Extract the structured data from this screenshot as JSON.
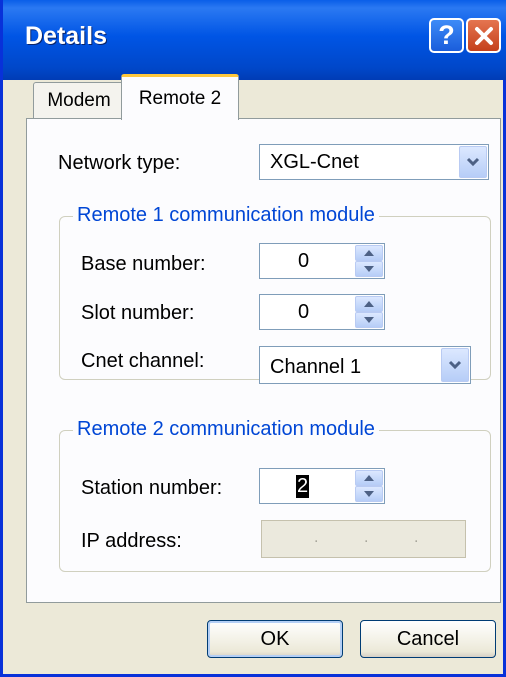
{
  "window": {
    "title": "Details"
  },
  "tabs": [
    {
      "label": "Modem",
      "selected": false
    },
    {
      "label": "Remote 2",
      "selected": true
    }
  ],
  "network_type": {
    "label": "Network type:",
    "value": "XGL-Cnet"
  },
  "remote1": {
    "title": "Remote 1 communication module",
    "base_number": {
      "label": "Base number:",
      "value": "0"
    },
    "slot_number": {
      "label": "Slot number:",
      "value": "0"
    },
    "cnet_channel": {
      "label": "Cnet channel:",
      "value": "Channel 1"
    }
  },
  "remote2": {
    "title": "Remote 2 communication module",
    "station_number": {
      "label": "Station number:",
      "value": "2"
    },
    "ip_address": {
      "label": "IP address:",
      "value": ""
    }
  },
  "buttons": {
    "ok": "OK",
    "cancel": "Cancel"
  },
  "colors": {
    "accent": "#0046d5",
    "titlebar": "#0055e5"
  }
}
